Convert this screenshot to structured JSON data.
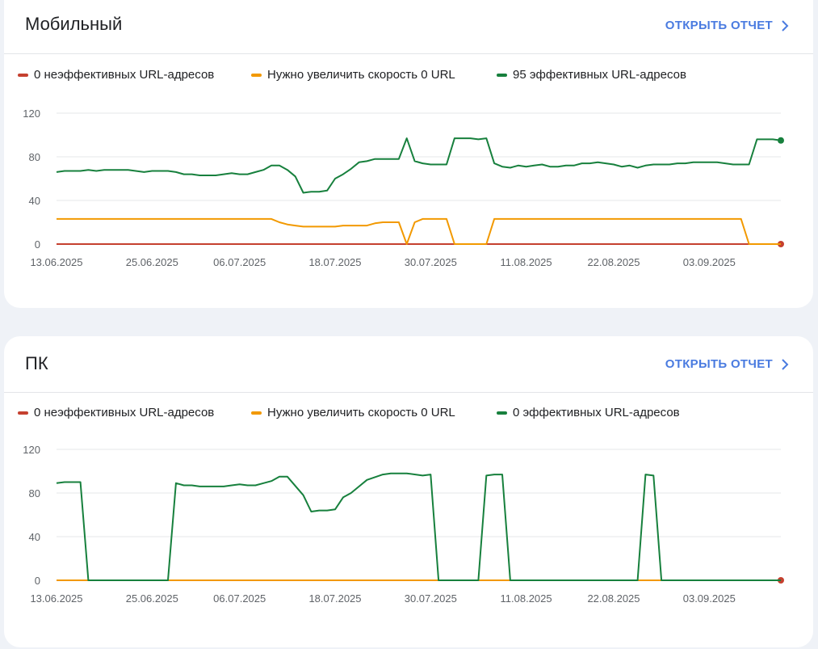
{
  "colors": {
    "poor": "#c5402f",
    "needs_improvement": "#f29900",
    "good": "#17803d",
    "link": "#4a7be0"
  },
  "cards": [
    {
      "id": "mobile",
      "title": "Мобильный",
      "open_report_label": "ОТКРЫТЬ ОТЧЕТ",
      "legend": [
        "0 неэффективных URL-адресов",
        "Нужно увеличить скорость 0 URL",
        "95 эффективных URL-адресов"
      ]
    },
    {
      "id": "pc",
      "title": "ПК",
      "open_report_label": "ОТКРЫТЬ ОТЧЕТ",
      "legend": [
        "0 неэффективных URL-адресов",
        "Нужно увеличить скорость 0 URL",
        "0 эффективных URL-адресов"
      ]
    }
  ],
  "chart_data": [
    {
      "type": "line",
      "x_tick_labels": [
        "13.06.2025",
        "25.06.2025",
        "06.07.2025",
        "18.07.2025",
        "30.07.2025",
        "11.08.2025",
        "22.08.2025",
        "03.09.2025"
      ],
      "y_ticks": [
        0,
        40,
        80,
        120
      ],
      "ylim": [
        0,
        120
      ],
      "x_start": "13.06.2025",
      "x_end": "12.09.2025",
      "grid": true,
      "series": [
        {
          "name": "0 неэффективных URL-адресов",
          "color_key": "poor",
          "points": [
            [
              "13.06.2025",
              0
            ],
            [
              "12.09.2025",
              0
            ]
          ],
          "end_marker": true
        },
        {
          "name": "Нужно увеличить скорость 0 URL",
          "color_key": "needs_improvement",
          "points": [
            [
              "13.06.2025",
              23
            ],
            [
              "10.07.2025",
              23
            ],
            [
              "11.07.2025",
              20
            ],
            [
              "12.07.2025",
              18
            ],
            [
              "13.07.2025",
              17
            ],
            [
              "14.07.2025",
              16
            ],
            [
              "18.07.2025",
              16
            ],
            [
              "19.07.2025",
              17
            ],
            [
              "22.07.2025",
              17
            ],
            [
              "23.07.2025",
              19
            ],
            [
              "24.07.2025",
              20
            ],
            [
              "26.07.2025",
              20
            ],
            [
              "27.07.2025",
              0
            ],
            [
              "28.07.2025",
              20
            ],
            [
              "29.07.2025",
              23
            ],
            [
              "01.08.2025",
              23
            ],
            [
              "02.08.2025",
              0
            ],
            [
              "06.08.2025",
              0
            ],
            [
              "07.08.2025",
              23
            ],
            [
              "07.09.2025",
              23
            ],
            [
              "08.09.2025",
              0
            ],
            [
              "12.09.2025",
              0
            ]
          ]
        },
        {
          "name": "95 эффективных URL-адресов",
          "color_key": "good",
          "points": [
            [
              "13.06.2025",
              66
            ],
            [
              "14.06.2025",
              67
            ],
            [
              "16.06.2025",
              67
            ],
            [
              "17.06.2025",
              68
            ],
            [
              "18.06.2025",
              67
            ],
            [
              "19.06.2025",
              68
            ],
            [
              "22.06.2025",
              68
            ],
            [
              "24.06.2025",
              66
            ],
            [
              "25.06.2025",
              67
            ],
            [
              "27.06.2025",
              67
            ],
            [
              "28.06.2025",
              66
            ],
            [
              "29.06.2025",
              64
            ],
            [
              "30.06.2025",
              64
            ],
            [
              "01.07.2025",
              63
            ],
            [
              "03.07.2025",
              63
            ],
            [
              "04.07.2025",
              64
            ],
            [
              "05.07.2025",
              65
            ],
            [
              "06.07.2025",
              64
            ],
            [
              "07.07.2025",
              64
            ],
            [
              "08.07.2025",
              66
            ],
            [
              "09.07.2025",
              68
            ],
            [
              "10.07.2025",
              72
            ],
            [
              "11.07.2025",
              72
            ],
            [
              "12.07.2025",
              68
            ],
            [
              "13.07.2025",
              62
            ],
            [
              "14.07.2025",
              47
            ],
            [
              "15.07.2025",
              48
            ],
            [
              "16.07.2025",
              48
            ],
            [
              "17.07.2025",
              49
            ],
            [
              "18.07.2025",
              60
            ],
            [
              "19.07.2025",
              64
            ],
            [
              "20.07.2025",
              69
            ],
            [
              "21.07.2025",
              75
            ],
            [
              "22.07.2025",
              76
            ],
            [
              "23.07.2025",
              78
            ],
            [
              "25.07.2025",
              78
            ],
            [
              "26.07.2025",
              78
            ],
            [
              "27.07.2025",
              97
            ],
            [
              "28.07.2025",
              76
            ],
            [
              "29.07.2025",
              74
            ],
            [
              "30.07.2025",
              73
            ],
            [
              "31.07.2025",
              73
            ],
            [
              "01.08.2025",
              73
            ],
            [
              "02.08.2025",
              97
            ],
            [
              "04.08.2025",
              97
            ],
            [
              "05.08.2025",
              96
            ],
            [
              "06.08.2025",
              97
            ],
            [
              "07.08.2025",
              74
            ],
            [
              "08.08.2025",
              71
            ],
            [
              "09.08.2025",
              70
            ],
            [
              "10.08.2025",
              72
            ],
            [
              "11.08.2025",
              71
            ],
            [
              "12.08.2025",
              72
            ],
            [
              "13.08.2025",
              73
            ],
            [
              "14.08.2025",
              71
            ],
            [
              "15.08.2025",
              71
            ],
            [
              "16.08.2025",
              72
            ],
            [
              "17.08.2025",
              72
            ],
            [
              "18.08.2025",
              74
            ],
            [
              "19.08.2025",
              74
            ],
            [
              "20.08.2025",
              75
            ],
            [
              "21.08.2025",
              74
            ],
            [
              "22.08.2025",
              73
            ],
            [
              "23.08.2025",
              71
            ],
            [
              "24.08.2025",
              72
            ],
            [
              "25.08.2025",
              70
            ],
            [
              "26.08.2025",
              72
            ],
            [
              "27.08.2025",
              73
            ],
            [
              "29.08.2025",
              73
            ],
            [
              "30.08.2025",
              74
            ],
            [
              "31.08.2025",
              74
            ],
            [
              "01.09.2025",
              75
            ],
            [
              "04.09.2025",
              75
            ],
            [
              "05.09.2025",
              74
            ],
            [
              "06.09.2025",
              73
            ],
            [
              "08.09.2025",
              73
            ],
            [
              "09.09.2025",
              96
            ],
            [
              "11.09.2025",
              96
            ],
            [
              "12.09.2025",
              95
            ]
          ],
          "end_marker": true
        }
      ]
    },
    {
      "type": "line",
      "x_tick_labels": [
        "13.06.2025",
        "25.06.2025",
        "06.07.2025",
        "18.07.2025",
        "30.07.2025",
        "11.08.2025",
        "22.08.2025",
        "03.09.2025"
      ],
      "y_ticks": [
        0,
        40,
        80,
        120
      ],
      "ylim": [
        0,
        120
      ],
      "x_start": "13.06.2025",
      "x_end": "12.09.2025",
      "grid": true,
      "series": [
        {
          "name": "0 неэффективных URL-адресов",
          "color_key": "poor",
          "points": [
            [
              "13.06.2025",
              0
            ],
            [
              "12.09.2025",
              0
            ]
          ],
          "end_marker": true
        },
        {
          "name": "Нужно увеличить скорость 0 URL",
          "color_key": "needs_improvement",
          "points": [
            [
              "13.06.2025",
              0
            ],
            [
              "12.09.2025",
              0
            ]
          ]
        },
        {
          "name": "0 эффективных URL-адресов",
          "color_key": "good",
          "points": [
            [
              "13.06.2025",
              89
            ],
            [
              "14.06.2025",
              90
            ],
            [
              "16.06.2025",
              90
            ],
            [
              "17.06.2025",
              0
            ],
            [
              "27.06.2025",
              0
            ],
            [
              "28.06.2025",
              89
            ],
            [
              "29.06.2025",
              87
            ],
            [
              "30.06.2025",
              87
            ],
            [
              "01.07.2025",
              86
            ],
            [
              "04.07.2025",
              86
            ],
            [
              "05.07.2025",
              87
            ],
            [
              "06.07.2025",
              88
            ],
            [
              "07.07.2025",
              87
            ],
            [
              "08.07.2025",
              87
            ],
            [
              "09.07.2025",
              89
            ],
            [
              "10.07.2025",
              91
            ],
            [
              "11.07.2025",
              95
            ],
            [
              "12.07.2025",
              95
            ],
            [
              "14.07.2025",
              78
            ],
            [
              "15.07.2025",
              63
            ],
            [
              "16.07.2025",
              64
            ],
            [
              "17.07.2025",
              64
            ],
            [
              "18.07.2025",
              65
            ],
            [
              "19.07.2025",
              76
            ],
            [
              "20.07.2025",
              80
            ],
            [
              "21.07.2025",
              86
            ],
            [
              "22.07.2025",
              92
            ],
            [
              "24.07.2025",
              97
            ],
            [
              "25.07.2025",
              98
            ],
            [
              "27.07.2025",
              98
            ],
            [
              "29.07.2025",
              96
            ],
            [
              "30.07.2025",
              97
            ],
            [
              "31.07.2025",
              0
            ],
            [
              "05.08.2025",
              0
            ],
            [
              "06.08.2025",
              96
            ],
            [
              "07.08.2025",
              97
            ],
            [
              "08.08.2025",
              97
            ],
            [
              "09.08.2025",
              0
            ],
            [
              "25.08.2025",
              0
            ],
            [
              "26.08.2025",
              97
            ],
            [
              "27.08.2025",
              96
            ],
            [
              "28.08.2025",
              0
            ],
            [
              "12.09.2025",
              0
            ]
          ]
        }
      ]
    }
  ]
}
